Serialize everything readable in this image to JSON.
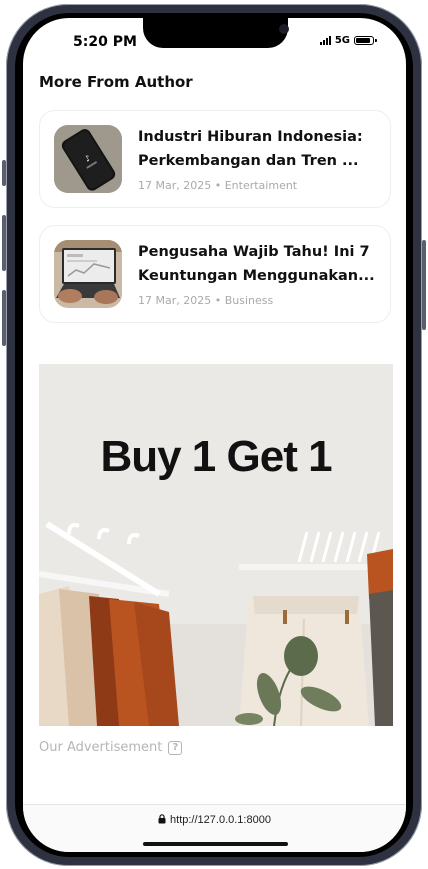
{
  "status_bar": {
    "time": "5:20 PM",
    "network": "5G"
  },
  "section": {
    "title": "More From Author"
  },
  "articles": [
    {
      "title_line1": "Industri Hiburan Indonesia:",
      "title_line2": "Perkembangan dan Tren ...",
      "meta": "17 Mar, 2025 • Entertaiment"
    },
    {
      "title_line1": "Pengusaha Wajib Tahu! Ini 7",
      "title_line2": "Keuntungan Menggunakan...",
      "meta": "17 Mar, 2025 • Business"
    }
  ],
  "ad": {
    "headline": "Buy 1 Get 1",
    "caption": "Our Advertisement"
  },
  "browser": {
    "url": "http://127.0.0.1:8000"
  }
}
